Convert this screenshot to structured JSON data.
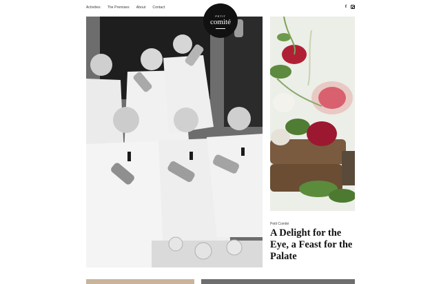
{
  "nav": {
    "items": [
      "Activities",
      "The Premises",
      "About",
      "Contact"
    ]
  },
  "social": {
    "icons": [
      "facebook-icon",
      "instagram-icon"
    ],
    "facebook_glyph": "f"
  },
  "logo": {
    "small": "PETIT",
    "big": "comité"
  },
  "article": {
    "category": "Petit Comité",
    "title": "A Delight for the Eye, a Feast for the Palate"
  },
  "colors": {
    "background": "#ffffff",
    "logo_bg": "#111111",
    "text": "#111111"
  }
}
